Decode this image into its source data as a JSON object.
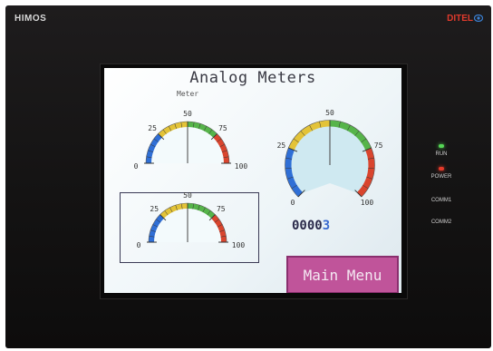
{
  "device": {
    "brand_left": "HIMOS",
    "brand_right": "DITEL",
    "leds": [
      {
        "label": "RUN",
        "color": "#55d655"
      },
      {
        "label": "POWER",
        "color": "#e53a2a"
      },
      {
        "label": "COMM1",
        "color": ""
      },
      {
        "label": "COMM2",
        "color": ""
      }
    ]
  },
  "screen": {
    "title": "Analog Meters",
    "meter_label": "Meter",
    "counter": {
      "digits": "0000",
      "last": "3"
    },
    "main_menu_label": "Main Menu"
  },
  "gauges": [
    {
      "id": "g1",
      "min": 0,
      "max": 100,
      "value": 50,
      "labels": [
        "0",
        "25",
        "50",
        "75",
        "100"
      ]
    },
    {
      "id": "g2",
      "min": 0,
      "max": 100,
      "value": 50,
      "labels": [
        "0",
        "25",
        "50",
        "75",
        "100"
      ]
    },
    {
      "id": "g3",
      "min": 0,
      "max": 100,
      "value": 50,
      "labels": [
        "0",
        "25",
        "50",
        "75",
        "100"
      ]
    }
  ],
  "colors": {
    "band_low": "#2f6fd6",
    "band_midlow": "#e3c338",
    "band_midhigh": "#56b44a",
    "band_high": "#d9452e",
    "accent_button": "#c0549a"
  }
}
